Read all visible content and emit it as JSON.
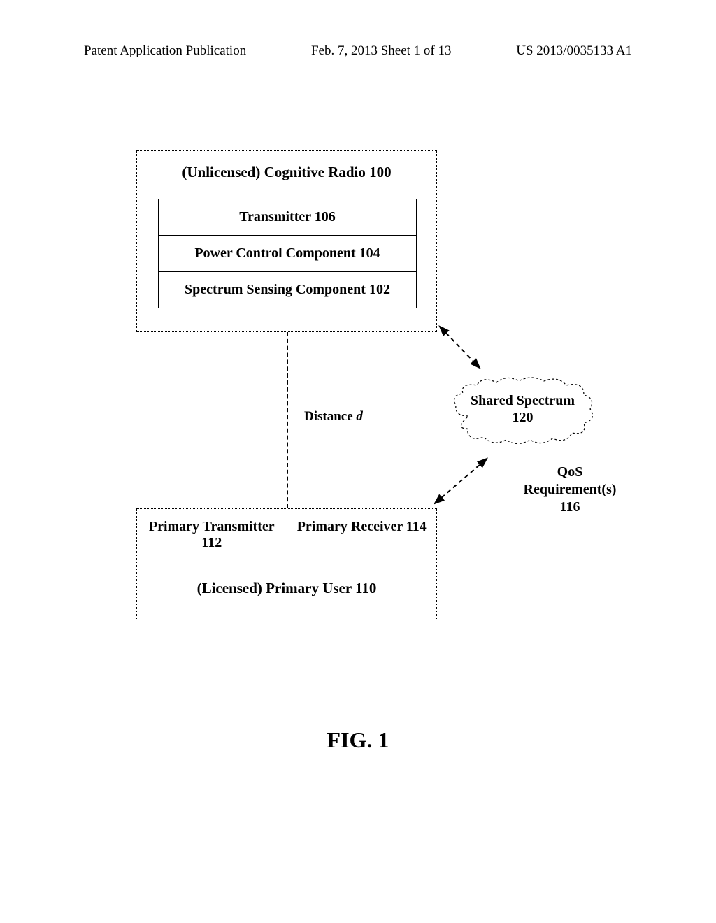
{
  "header": {
    "left": "Patent Application Publication",
    "center": "Feb. 7, 2013  Sheet 1 of 13",
    "right": "US 2013/0035133 A1"
  },
  "cogRadio": {
    "title": "(Unlicensed) Cognitive Radio 100",
    "transmitter": "Transmitter 106",
    "powerControl": "Power Control Component 104",
    "spectrumSensing": "Spectrum Sensing Component 102"
  },
  "distance": {
    "prefix": "Distance ",
    "var": "d"
  },
  "primaryUser": {
    "title": "(Licensed) Primary User 110",
    "transmitter": "Primary Transmitter 112",
    "receiver": "Primary Receiver 114"
  },
  "cloud": {
    "line1": "Shared Spectrum",
    "line2": "120"
  },
  "qos": {
    "line1": "QoS",
    "line2": "Requirement(s)",
    "line3": "116"
  },
  "figure": "FIG. 1"
}
